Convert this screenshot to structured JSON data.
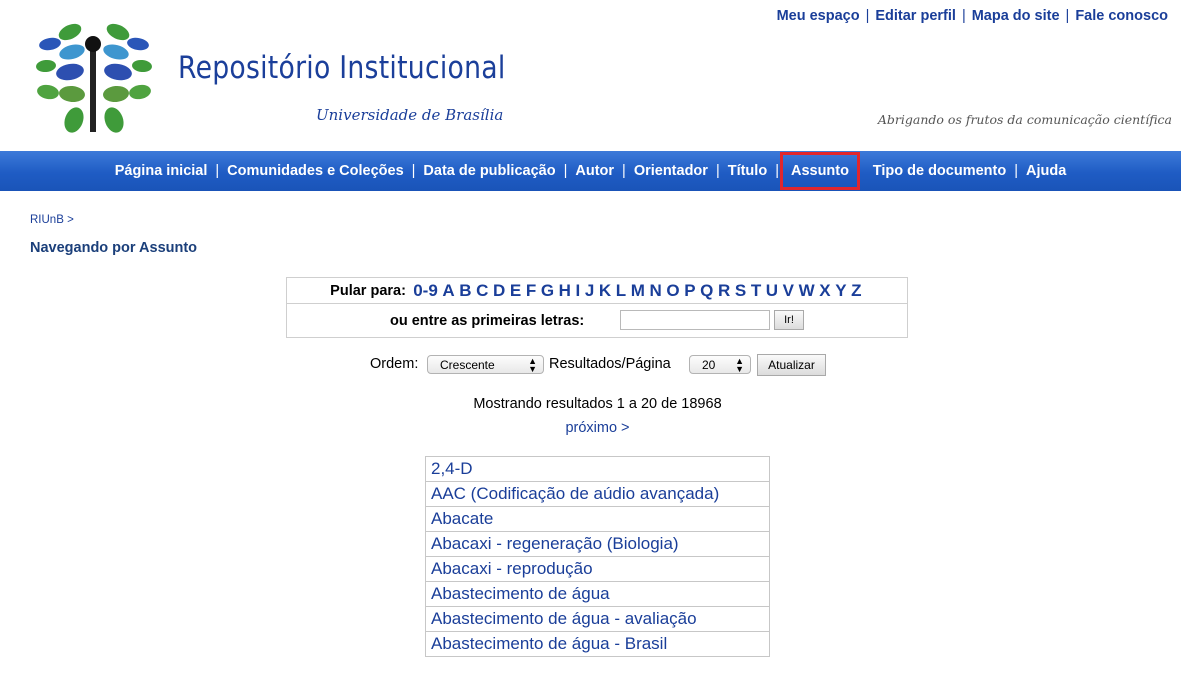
{
  "header": {
    "top_links": [
      "Meu espaço",
      "Editar perfil",
      "Mapa do site",
      "Fale conosco"
    ],
    "title": "Repositório Institucional",
    "subtitle": "Universidade de Brasília",
    "tagline": "Abrigando os frutos da comunicação científica"
  },
  "nav": {
    "items": [
      "Página inicial",
      "Comunidades e Coleções",
      "Data de publicação",
      "Autor",
      "Orientador",
      "Título",
      "Assunto",
      "Tipo de documento",
      "Ajuda"
    ],
    "active": "Assunto",
    "active_outline_color": "#e0262d"
  },
  "breadcrumb": "RIUnB >",
  "page_heading": "Navegando por Assunto",
  "jump": {
    "label": "Pular para:",
    "letters": [
      "0-9",
      "A",
      "B",
      "C",
      "D",
      "E",
      "F",
      "G",
      "H",
      "I",
      "J",
      "K",
      "L",
      "M",
      "N",
      "O",
      "P",
      "Q",
      "R",
      "S",
      "T",
      "U",
      "V",
      "W",
      "X",
      "Y",
      "Z"
    ],
    "starts_label": "ou entre as primeiras letras:",
    "starts_value": "",
    "go_label": "Ir!"
  },
  "controls": {
    "order_label": "Ordem:",
    "order_value": "Crescente",
    "rpp_label": "Resultados/Página",
    "rpp_value": "20",
    "update_label": "Atualizar"
  },
  "results": {
    "info": "Mostrando resultados 1 a 20 de 18968",
    "next": "próximo >"
  },
  "subjects": [
    "2,4-D",
    "AAC (Codificação de aúdio avançada)",
    "Abacate",
    "Abacaxi - regeneração (Biologia)",
    "Abacaxi - reprodução",
    "Abastecimento de água",
    "Abastecimento de água - avaliação",
    "Abastecimento de água - Brasil"
  ],
  "colors": {
    "link": "#1a3e99",
    "nav_bg": "#1f5cc4"
  }
}
